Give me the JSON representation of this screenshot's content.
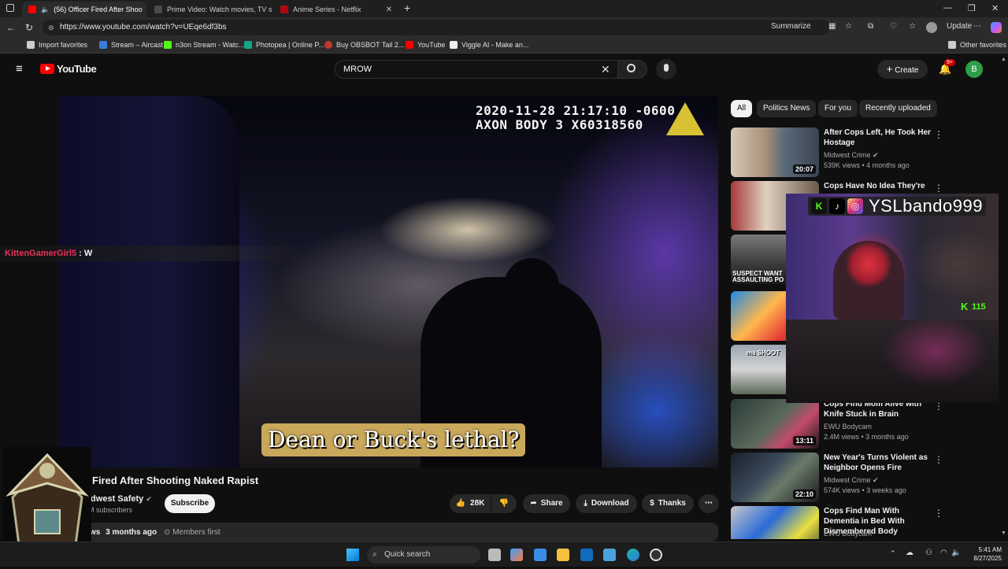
{
  "browser": {
    "tabs": [
      {
        "label": "(56) Officer Fired After Shoo",
        "active": true
      },
      {
        "label": "Prime Video: Watch movies, TV sl",
        "active": false
      },
      {
        "label": "Anime Series - Netflix",
        "active": false
      }
    ],
    "url": "https://www.youtube.com/watch?v=UEqe6df3bs",
    "summarize_label": "Summarize",
    "update_label": "Update",
    "bookmarks": [
      "Import favorites",
      "Stream – Aircast",
      "n3on Stream - Watc...",
      "Photopea | Online P...",
      "Buy OBSBOT Tail 2...",
      "YouTube",
      "Viggle AI - Make an..."
    ],
    "other_favorites": "Other favorites"
  },
  "youtube": {
    "logo_text": "YouTube",
    "search_value": "MROW",
    "create_label": "Create",
    "notification_badge": "9+",
    "avatar_letter": "B"
  },
  "video": {
    "timestamp": "2020-11-28 21:17:10 -0600\nAXON BODY 3 X60318560",
    "subtitle": "Dean or Buck's lethal?",
    "chat_user": "KittenGamerGirl5",
    "chat_sep": " : ",
    "chat_message": "W",
    "title": "Fired After Shooting Naked Rapist",
    "channel": "idwest Safety",
    "subscribers": "M subscribers",
    "subscribe_label": "Subscribe",
    "likes": "28K",
    "share_label": "Share",
    "download_label": "Download",
    "thanks_label": "Thanks",
    "desc_views": "ws",
    "desc_age": "3 months ago",
    "members_first": "Members first"
  },
  "sidebar": {
    "chips": [
      "All",
      "Politics News",
      "For you",
      "Recently uploaded"
    ],
    "recs": [
      {
        "title": "After Cops Left, He Took Her Hostage",
        "channel": "Midwest Crime",
        "meta": "539K views • 4 months ago",
        "duration": "20:07"
      },
      {
        "title": "Cops Have No Idea They're",
        "channel": "",
        "meta": "",
        "duration": ""
      },
      {
        "title": "",
        "channel": "",
        "meta": "",
        "duration": ""
      },
      {
        "title": "",
        "channel": "",
        "meta": "",
        "duration": ""
      },
      {
        "title": "",
        "channel": "",
        "meta": "",
        "duration": ""
      },
      {
        "title": "Cops Find Mom Alive with Knife Stuck in Brain",
        "channel": "EWU Bodycam",
        "meta": "2.4M views • 3 months ago",
        "duration": "13:11"
      },
      {
        "title": "New Year's Turns Violent as Neighbor Opens Fire",
        "channel": "Midwest Crime",
        "meta": "574K views • 3 weeks ago",
        "duration": "22:10"
      },
      {
        "title": "Cops Find Man With Dementia in Bed With Dismembered Body",
        "channel": "EWU Bodycam",
        "meta": "",
        "duration": ""
      }
    ],
    "thumb_texts": [
      "SUSPECT WANT ASSAULTING PO",
      "ma SHOOT"
    ]
  },
  "stream_overlay": {
    "handle": "YSLbando999",
    "kick_count": "115"
  },
  "taskbar": {
    "search_placeholder": "Quick search",
    "time": "5:41 AM",
    "date": "8/27/2025"
  },
  "colors": {
    "yt_red": "#ff0000",
    "kick_green": "#53fc18",
    "chat_user": "#e8335a",
    "subtitle_box": "#c9a85b"
  }
}
